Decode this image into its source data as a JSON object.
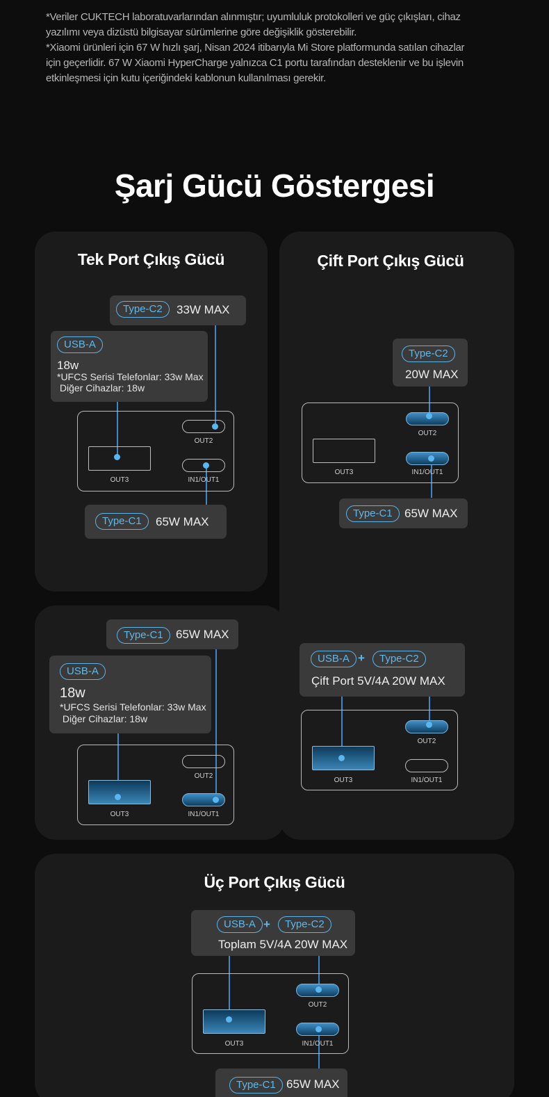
{
  "notes": [
    "*Veriler CUKTECH laboratuvarlarından alınmıştır; uyumluluk protokolleri ve güç çıkışları, cihaz",
    " yazılımı veya dizüstü bilgisayar sürümlerine göre değişiklik gösterebilir.",
    "*Xiaomi ürünleri için 67 W hızlı şarj, Nisan 2024 itibarıyla Mi Store platformunda satılan cihazlar",
    "için geçerlidir. 67 W Xiaomi HyperCharge yalnızca C1 portu tarafından desteklenir ve bu işlevin",
    "etkinleşmesi için kutu içeriğindeki kablonun kullanılması gerekir."
  ],
  "page_title": "Şarj Gücü Göstergesi",
  "ports": {
    "out2": "OUT2",
    "out3": "OUT3",
    "in1": "IN1/OUT1"
  },
  "single": {
    "title": "Tek Port Çıkış Gücü",
    "c2": {
      "pill": "Type-C2",
      "value": "33W MAX"
    },
    "a": {
      "pill": "USB-A",
      "power": "18w",
      "line1": "*UFCS Serisi Telefonlar: 33w Max",
      "line2": " Diğer Cihazlar: 18w"
    },
    "c1": {
      "pill": "Type-C1",
      "value": "65W MAX"
    },
    "c1b": {
      "pill": "Type-C1",
      "value": "65W MAX"
    },
    "ab": {
      "pill": "USB-A",
      "power": "18w",
      "line1": "*UFCS Serisi Telefonlar: 33w Max",
      "line2": " Diğer Cihazlar: 18w"
    }
  },
  "dual": {
    "title": "Çift Port Çıkış Gücü",
    "c2": {
      "pill": "Type-C2",
      "value": "20W MAX"
    },
    "c1": {
      "pill": "Type-C1",
      "value": "65W MAX"
    },
    "combo": {
      "pill1": "USB-A",
      "plus": "+",
      "pill2": "Type-C2",
      "value": "Çift Port 5V/4A 20W MAX"
    }
  },
  "triple": {
    "title": "Üç Port Çıkış Gücü",
    "combo": {
      "pill1": "USB-A",
      "plus": "+",
      "pill2": "Type-C2",
      "value": "Toplam 5V/4A 20W MAX"
    },
    "c1": {
      "pill": "Type-C1",
      "value": "65W MAX"
    }
  },
  "colors": {
    "background": "#0d0d0d",
    "card": "#1b1b1b",
    "label": "#3a3a3a",
    "accent": "#5bb4e8"
  }
}
